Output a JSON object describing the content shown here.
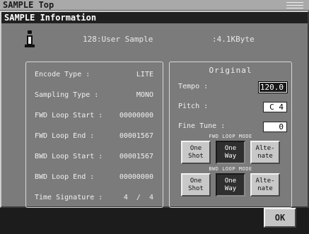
{
  "window": {
    "title": "SAMPLE Top"
  },
  "dialog": {
    "title": "SAMPLE Information",
    "sample_name": "128:User Sample",
    "sample_size": ":4.1KByte"
  },
  "info": [
    {
      "label": "Encode Type :",
      "value": "LITE"
    },
    {
      "label": "Sampling Type :",
      "value": "MONO"
    },
    {
      "label": "FWD Loop Start :",
      "value": "00000000"
    },
    {
      "label": "FWD Loop End :",
      "value": "00001567"
    },
    {
      "label": "BWD Loop Start :",
      "value": "00001567"
    },
    {
      "label": "BWD Loop End :",
      "value": "00000000"
    },
    {
      "label": "Time Signature :",
      "value": "4  /  4"
    }
  ],
  "original": {
    "title": "Original",
    "tempo_label": "Tempo :",
    "tempo_value": "120.0",
    "pitch_label": "Pitch :",
    "pitch_value": "C 4",
    "fine_tune_label": "Fine Tune :",
    "fine_tune_value": "0",
    "fwd_mode_title": "FWD LOOP MODE",
    "bwd_mode_title": "BWD LOOP MODE",
    "fwd_buttons": [
      {
        "label": "One\nShot",
        "active": false
      },
      {
        "label": "One\nWay",
        "active": true
      },
      {
        "label": "Alte-\nnate",
        "active": false
      }
    ],
    "bwd_buttons": [
      {
        "label": "One\nShot",
        "active": false
      },
      {
        "label": "One\nWay",
        "active": true
      },
      {
        "label": "Alte-\nnate",
        "active": false
      }
    ]
  },
  "footer": {
    "ok_label": "OK"
  },
  "icons": [
    "info-icon",
    "memory-indicator-icon"
  ]
}
